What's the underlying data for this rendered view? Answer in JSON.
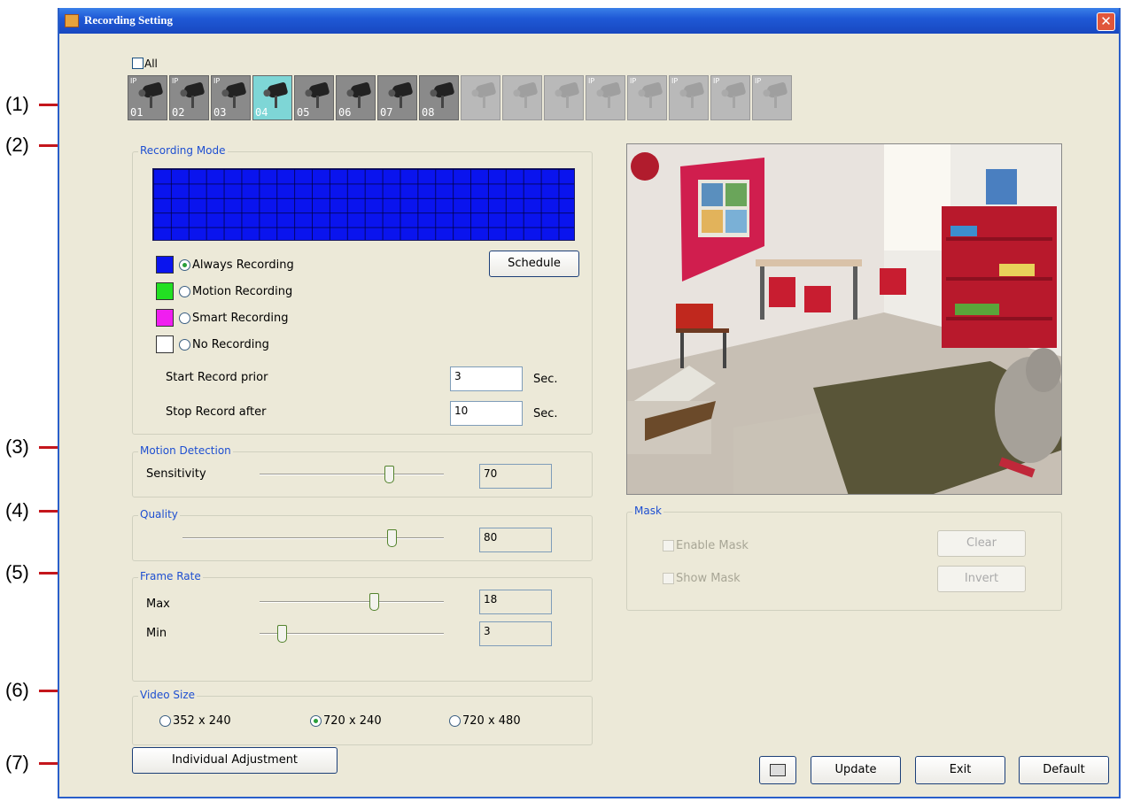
{
  "window": {
    "title": "Recording Setting"
  },
  "callouts": [
    "(1)",
    "(2)",
    "(3)",
    "(4)",
    "(5)",
    "(6)",
    "(7)"
  ],
  "cameras": {
    "all_label": "All",
    "items": [
      {
        "label": "01",
        "tag": "IP",
        "state": "enabled"
      },
      {
        "label": "02",
        "tag": "IP",
        "state": "enabled"
      },
      {
        "label": "03",
        "tag": "IP",
        "state": "enabled"
      },
      {
        "label": "04",
        "tag": "",
        "state": "selected"
      },
      {
        "label": "05",
        "tag": "",
        "state": "enabled"
      },
      {
        "label": "06",
        "tag": "",
        "state": "enabled"
      },
      {
        "label": "07",
        "tag": "",
        "state": "enabled"
      },
      {
        "label": "08",
        "tag": "",
        "state": "enabled"
      },
      {
        "label": "",
        "tag": "",
        "state": "disabled"
      },
      {
        "label": "",
        "tag": "",
        "state": "disabled"
      },
      {
        "label": "",
        "tag": "",
        "state": "disabled"
      },
      {
        "label": "",
        "tag": "IP",
        "state": "disabled"
      },
      {
        "label": "",
        "tag": "IP",
        "state": "disabled"
      },
      {
        "label": "",
        "tag": "IP",
        "state": "disabled"
      },
      {
        "label": "",
        "tag": "IP",
        "state": "disabled"
      },
      {
        "label": "",
        "tag": "IP",
        "state": "disabled"
      }
    ]
  },
  "recording_mode": {
    "legend": "Recording Mode",
    "schedule_button": "Schedule",
    "modes": [
      {
        "label": "Always Recording",
        "color": "#0a14ee",
        "selected": true
      },
      {
        "label": "Motion Recording",
        "color": "#22e022",
        "selected": false
      },
      {
        "label": "Smart Recording",
        "color": "#f01ef0",
        "selected": false
      },
      {
        "label": "No Recording",
        "color": "#ffffff",
        "selected": false
      }
    ],
    "start_prior_label": "Start Record prior",
    "start_prior_value": "3",
    "stop_after_label": "Stop Record after",
    "stop_after_value": "10",
    "unit": "Sec."
  },
  "motion_detection": {
    "legend": "Motion Detection",
    "label": "Sensitivity",
    "value": "70",
    "level": 0.7
  },
  "quality": {
    "legend": "Quality",
    "value": "80",
    "level": 0.8
  },
  "frame_rate": {
    "legend": "Frame Rate",
    "max_label": "Max",
    "max_value": "18",
    "max_level": 0.62,
    "min_label": "Min",
    "min_value": "3",
    "min_level": 0.12
  },
  "video_size": {
    "legend": "Video Size",
    "options": [
      {
        "label": "352 x 240",
        "selected": false
      },
      {
        "label": "720 x 240",
        "selected": true
      },
      {
        "label": "720 x 480",
        "selected": false
      }
    ]
  },
  "individual_adjustment": "Individual Adjustment",
  "mask": {
    "legend": "Mask",
    "enable_label": "Enable Mask",
    "show_label": "Show Mask",
    "clear_button": "Clear",
    "invert_button": "Invert"
  },
  "footer": {
    "update": "Update",
    "exit": "Exit",
    "default": "Default"
  }
}
